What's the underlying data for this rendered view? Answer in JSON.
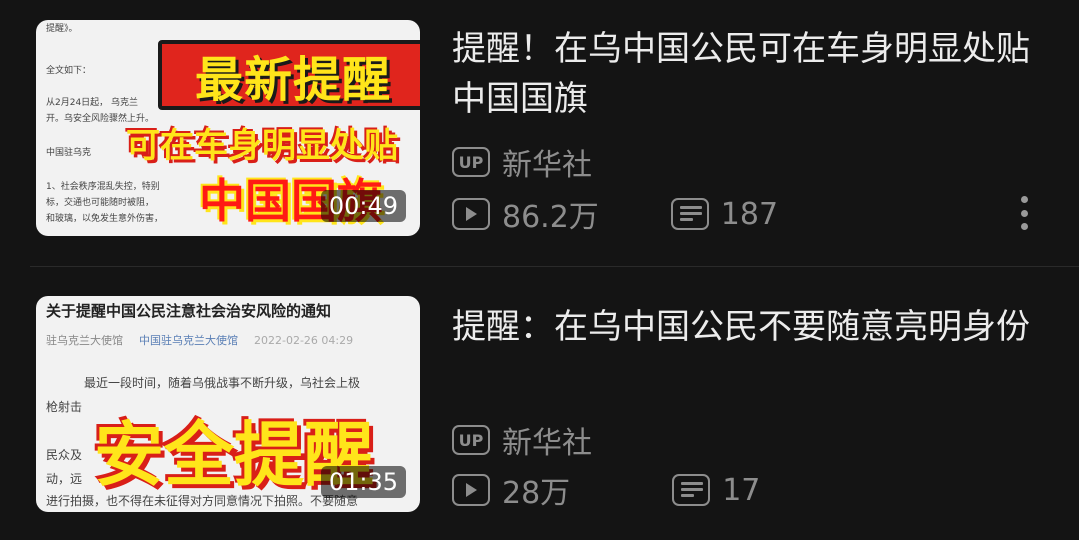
{
  "videos": [
    {
      "title": "提醒！在乌中国公民可在车身明显处贴中国国旗",
      "author": "新华社",
      "up_badge": "UP",
      "views": "86.2万",
      "comments": "187",
      "duration": "00:49",
      "thumbnail": {
        "banner_main": "最新提醒",
        "banner_sub": "可在车身明显处贴",
        "banner_flag": "中国国旗",
        "doc_lines": [
          "提醒》。",
          "全文如下：",
          "从2月24日起，  乌克兰",
          "开。乌安全风险骤然上升。",
          "中国驻乌克",
          "1、社会秩序混乱失控，特别",
          "标，交通也可能随时被阻，",
          "和玻璃，以免发生意外伤害，"
        ]
      }
    },
    {
      "title": "提醒：在乌中国公民不要随意亮明身份",
      "author": "新华社",
      "up_badge": "UP",
      "views": "28万",
      "comments": "17",
      "duration": "01:35",
      "thumbnail": {
        "doc_title": "关于提醒中国公民注意社会治安风险的通知",
        "doc_source": "驻乌克兰大使馆",
        "doc_org": "中国驻乌克兰大使馆",
        "doc_date": "2022-02-26 04:29",
        "doc_lines": [
          "最近一段时间，随着乌俄战事不断升级，乌社会上极",
          "枪射击",
          "民众及",
          "动，远",
          "进行拍摄，也不得在未征得对方同意情况下拍照。不要随意"
        ],
        "banner_main": "安全提醒"
      }
    }
  ]
}
